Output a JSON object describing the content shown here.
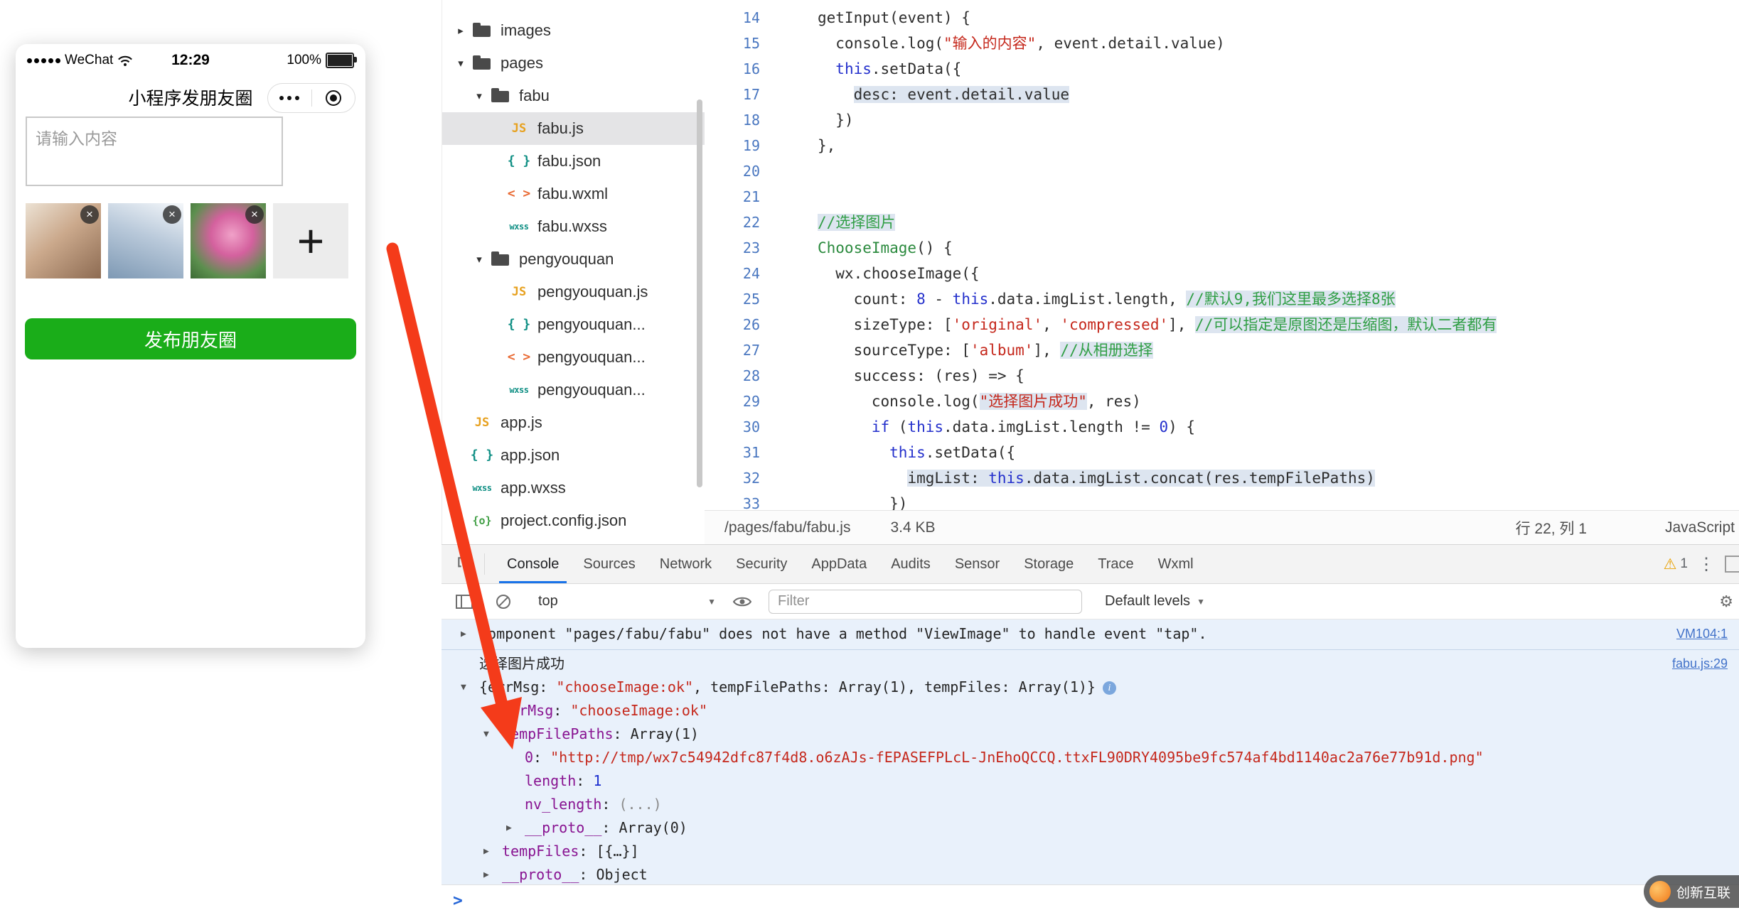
{
  "simulator": {
    "status": {
      "carrier": "WeChat",
      "time": "12:29",
      "battery": "100%"
    },
    "nav": {
      "title": "小程序发朋友圈"
    },
    "composer": {
      "placeholder": "请输入内容",
      "value": ""
    },
    "thumbs": [
      {
        "name": "photo-person",
        "close": "×"
      },
      {
        "name": "photo-sky",
        "close": "×"
      },
      {
        "name": "photo-flower",
        "close": "×"
      }
    ],
    "add_label": "+",
    "publish_button": "发布朋友圈"
  },
  "filetree": {
    "items": [
      {
        "label": "images",
        "icon": "folder",
        "arrow": "right",
        "level": 0
      },
      {
        "label": "pages",
        "icon": "folder",
        "arrow": "down",
        "level": 0
      },
      {
        "label": "fabu",
        "icon": "folder",
        "arrow": "down",
        "level": 1
      },
      {
        "label": "fabu.js",
        "icon": "js",
        "level": 2,
        "selected": true
      },
      {
        "label": "fabu.json",
        "icon": "json",
        "level": 2
      },
      {
        "label": "fabu.wxml",
        "icon": "wxml",
        "level": 2
      },
      {
        "label": "fabu.wxss",
        "icon": "wxss",
        "level": 2
      },
      {
        "label": "pengyouquan",
        "icon": "folder",
        "arrow": "down",
        "level": 1
      },
      {
        "label": "pengyouquan.js",
        "icon": "js",
        "level": 2
      },
      {
        "label": "pengyouquan...",
        "icon": "json",
        "level": 2
      },
      {
        "label": "pengyouquan...",
        "icon": "wxml",
        "level": 2
      },
      {
        "label": "pengyouquan...",
        "icon": "wxss",
        "level": 2
      },
      {
        "label": "app.js",
        "icon": "js",
        "level": 0
      },
      {
        "label": "app.json",
        "icon": "json",
        "level": 0
      },
      {
        "label": "app.wxss",
        "icon": "wxss",
        "level": 0
      },
      {
        "label": "project.config.json",
        "icon": "config",
        "level": 0
      }
    ]
  },
  "editor": {
    "lines": [
      {
        "no": 14,
        "tokens": [
          [
            "p",
            "getInput(event) {"
          ]
        ]
      },
      {
        "no": 15,
        "tokens": [
          [
            "p",
            "  console.log("
          ],
          [
            "s",
            "\"输入的内容\""
          ],
          [
            "p",
            ", event.detail.value)"
          ]
        ]
      },
      {
        "no": 16,
        "tokens": [
          [
            "p",
            "  "
          ],
          [
            "k",
            "this"
          ],
          [
            "p",
            ".setData({"
          ]
        ]
      },
      {
        "no": 17,
        "tokens": [
          [
            "p",
            "    "
          ],
          [
            "p",
            "desc: event.detail.value",
            1
          ]
        ]
      },
      {
        "no": 18,
        "tokens": [
          [
            "p",
            "  })"
          ]
        ]
      },
      {
        "no": 19,
        "tokens": [
          [
            "p",
            "},"
          ]
        ]
      },
      {
        "no": 20,
        "tokens": []
      },
      {
        "no": 21,
        "tokens": []
      },
      {
        "no": 22,
        "tokens": [
          [
            "c",
            "//选择图片",
            1
          ]
        ]
      },
      {
        "no": 23,
        "tokens": [
          [
            "f",
            "ChooseImage"
          ],
          [
            "p",
            "() {"
          ]
        ]
      },
      {
        "no": 24,
        "tokens": [
          [
            "p",
            "  wx.chooseImage({"
          ]
        ]
      },
      {
        "no": 25,
        "tokens": [
          [
            "p",
            "    count: "
          ],
          [
            "n",
            "8"
          ],
          [
            "p",
            " - "
          ],
          [
            "k",
            "this"
          ],
          [
            "p",
            ".data.imgList.length, "
          ],
          [
            "c",
            "//默认9,我们这里最多选择8张",
            1
          ]
        ]
      },
      {
        "no": 26,
        "tokens": [
          [
            "p",
            "    sizeType: ["
          ],
          [
            "s",
            "'original'"
          ],
          [
            "p",
            ", "
          ],
          [
            "s",
            "'compressed'"
          ],
          [
            "p",
            "], "
          ],
          [
            "c",
            "//可以指定是原图还是压缩图，默认二者都有",
            1
          ]
        ]
      },
      {
        "no": 27,
        "tokens": [
          [
            "p",
            "    sourceType: ["
          ],
          [
            "s",
            "'album'"
          ],
          [
            "p",
            "], "
          ],
          [
            "c",
            "//从相册选择",
            1
          ]
        ]
      },
      {
        "no": 28,
        "tokens": [
          [
            "p",
            "    success: (res) => {"
          ]
        ]
      },
      {
        "no": 29,
        "tokens": [
          [
            "p",
            "      console.log("
          ],
          [
            "s",
            "\"选择图片成功\"",
            1
          ],
          [
            "p",
            ", res)"
          ]
        ]
      },
      {
        "no": 30,
        "tokens": [
          [
            "p",
            "      "
          ],
          [
            "k",
            "if"
          ],
          [
            "p",
            " ("
          ],
          [
            "k",
            "this"
          ],
          [
            "p",
            ".data.imgList.length != "
          ],
          [
            "n",
            "0"
          ],
          [
            "p",
            ") {"
          ]
        ]
      },
      {
        "no": 31,
        "tokens": [
          [
            "p",
            "        "
          ],
          [
            "k",
            "this"
          ],
          [
            "p",
            ".setData({"
          ]
        ]
      },
      {
        "no": 32,
        "tokens": [
          [
            "p",
            "          "
          ],
          [
            "p",
            "imgList: ",
            1
          ],
          [
            "k",
            "this",
            1
          ],
          [
            "p",
            ".data.imgList.concat(res.tempFilePaths)",
            1
          ]
        ]
      },
      {
        "no": 33,
        "tokens": [
          [
            "p",
            "        })"
          ]
        ]
      }
    ],
    "statusbar": {
      "path": "/pages/fabu/fabu.js",
      "size": "3.4 KB",
      "cursor": "行 22, 列 1",
      "language": "JavaScript"
    }
  },
  "devtools": {
    "tabs": [
      "Console",
      "Sources",
      "Network",
      "Security",
      "AppData",
      "Audits",
      "Sensor",
      "Storage",
      "Trace",
      "Wxml"
    ],
    "active_tab": "Console",
    "warning_count": "1",
    "toolbar": {
      "context": "top",
      "filter_placeholder": "Filter",
      "levels": "Default levels"
    },
    "console": {
      "prompt": ">",
      "rows": [
        {
          "indent": 0,
          "caret": "right",
          "sep": true,
          "link": "VM104:1",
          "segments": [
            [
              "p",
              "Component \"pages/fabu/fabu\" does not have a method \"ViewImage\" to handle event \"tap\"."
            ]
          ]
        },
        {
          "indent": 0,
          "link": "fabu.js:29",
          "segments": [
            [
              "p",
              "选择图片成功"
            ]
          ]
        },
        {
          "indent": 0,
          "caret": "down",
          "info": true,
          "segments": [
            [
              "p",
              "{errMsg: "
            ],
            [
              "str",
              "\"chooseImage:ok\""
            ],
            [
              "p",
              ", tempFilePaths: Array(1), tempFiles: Array(1)}"
            ]
          ]
        },
        {
          "indent": 1,
          "segments": [
            [
              "key",
              "errMsg"
            ],
            [
              "p",
              ": "
            ],
            [
              "str",
              "\"chooseImage:ok\""
            ]
          ]
        },
        {
          "indent": 1,
          "caret": "down",
          "segments": [
            [
              "key",
              "tempFilePaths"
            ],
            [
              "p",
              ": Array(1)"
            ]
          ]
        },
        {
          "indent": 2,
          "segments": [
            [
              "key",
              "0"
            ],
            [
              "p",
              ": "
            ],
            [
              "str",
              "\"http://tmp/wx7c54942dfc87f4d8.o6zAJs-fEPASEFPLcL-JnEhoQCCQ.ttxFL90DRY4095be9fc574af4bd1140ac2a76e77b91d.png\""
            ]
          ]
        },
        {
          "indent": 2,
          "segments": [
            [
              "key",
              "length"
            ],
            [
              "p",
              ": "
            ],
            [
              "num",
              "1"
            ]
          ]
        },
        {
          "indent": 2,
          "segments": [
            [
              "key",
              "nv_length"
            ],
            [
              "p",
              ": "
            ],
            [
              "grey",
              "(...)"
            ]
          ]
        },
        {
          "indent": 2,
          "caret": "right",
          "segments": [
            [
              "key",
              "__proto__"
            ],
            [
              "p",
              ": Array(0)"
            ]
          ]
        },
        {
          "indent": 1,
          "caret": "right",
          "segments": [
            [
              "key",
              "tempFiles"
            ],
            [
              "p",
              ": [{…}]"
            ]
          ]
        },
        {
          "indent": 1,
          "caret": "right",
          "segments": [
            [
              "key",
              "__proto__"
            ],
            [
              "p",
              ": Object"
            ]
          ]
        }
      ]
    }
  },
  "watermark": {
    "text": "创新互联"
  }
}
